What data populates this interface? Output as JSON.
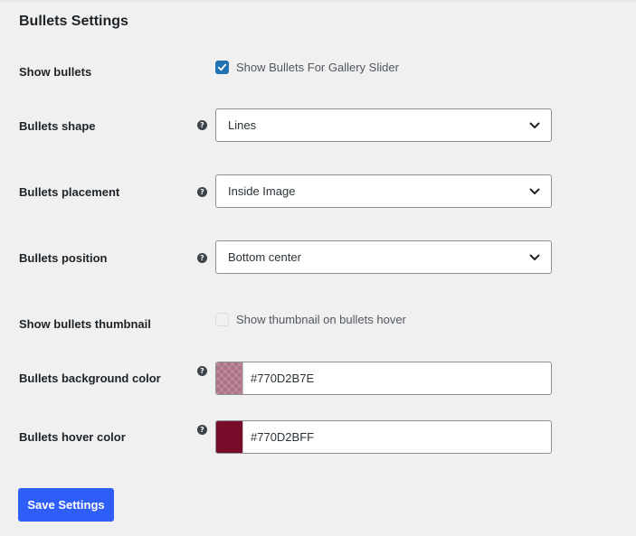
{
  "page": {
    "title": "Bullets Settings"
  },
  "colors": {
    "accent": "#2271b1",
    "save_button": "#2e5ef7",
    "bullets_background_swatch": "#770D2B7E",
    "bullets_hover_swatch": "#770D2BFF"
  },
  "rows": {
    "show_bullets": {
      "label": "Show bullets",
      "checkbox_label": "Show Bullets For Gallery Slider",
      "checked": true
    },
    "bullets_shape": {
      "label": "Bullets shape",
      "help_icon": "question-circle-icon",
      "value": "Lines"
    },
    "bullets_placement": {
      "label": "Bullets placement",
      "help_icon": "question-circle-icon",
      "value": "Inside Image"
    },
    "bullets_position": {
      "label": "Bullets position",
      "help_icon": "question-circle-icon",
      "value": "Bottom center"
    },
    "show_bullets_thumbnail": {
      "label": "Show bullets thumbnail",
      "checkbox_label": "Show thumbnail on bullets hover",
      "checked": false
    },
    "bullets_background_color": {
      "label": "Bullets background color",
      "help_icon": "question-circle-icon",
      "value": "#770D2B7E"
    },
    "bullets_hover_color": {
      "label": "Bullets hover color",
      "help_icon": "question-circle-icon",
      "value": "#770D2BFF"
    }
  },
  "actions": {
    "save_label": "Save Settings"
  }
}
